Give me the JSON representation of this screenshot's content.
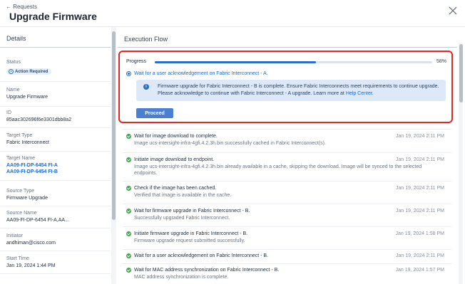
{
  "header": {
    "back_label": "← Requests",
    "title": "Upgrade Firmware"
  },
  "sidebar": {
    "title": "Details",
    "fields": [
      {
        "label": "Status",
        "badge": "Action Required"
      },
      {
        "label": "Name",
        "value": "Upgrade Firmware"
      },
      {
        "label": "ID",
        "value": "85aac302696f6e3301dbb8a2"
      },
      {
        "label": "Target Type",
        "value": "Fabric Interconnect"
      },
      {
        "label": "Target Name",
        "links": [
          "AA09-FI-DP-6454 FI-A",
          "AA09-FI-DP-6454 FI-B"
        ]
      },
      {
        "label": "Source Type",
        "value": "Firmware Upgrade"
      },
      {
        "label": "Source Name",
        "value": "AA09-FI-DP-6454 FI-A,AA..."
      },
      {
        "label": "Initiator",
        "value": "andhiman@cisco.com"
      },
      {
        "label": "Start Time",
        "value": "Jan 19, 2024 1:44 PM"
      }
    ]
  },
  "main": {
    "title": "Execution Flow",
    "progress_label": "Progress",
    "progress_percent": 58,
    "progress_text": "58%",
    "current_step": "Wait for a user acknowledgement on Fabric Interconnect - A.",
    "info_text_1": "Firmware upgrade for Fabric Interconnect - B is complete. Ensure Fabric Interconnects meet requirements to continue upgrade.",
    "info_text_2": "Please acknowledge to continue with Fabric Interconnect - A upgrade. Learn more at ",
    "info_link": "Help Center.",
    "proceed_label": "Proceed",
    "steps": [
      {
        "title": "Wait for image download to complete.",
        "detail": "Image ucs-intersight-infra-4gfi.4.2.3h.bin successfully cached in Fabric Interconnect(s).",
        "time": "Jan 19, 2024 2:11 PM"
      },
      {
        "title": "Initiate image download to endpoint.",
        "detail": "Image ucs-intersight-infra-4gfi.4.2.3h.bin already available in a cache, skipping the download. Image will be synced to the selected endpoints.",
        "time": "Jan 19, 2024 2:11 PM"
      },
      {
        "title": "Check if the image has been cached.",
        "detail": "Verified that image is available in the cache.",
        "time": "Jan 19, 2024 2:11 PM"
      },
      {
        "title": "Wait for firmware upgrade in Fabric Interconnect - B.",
        "detail": "Successfully upgraded Fabric Interconnect.",
        "time": "Jan 19, 2024 2:11 PM"
      },
      {
        "title": "Initiate firmware upgrade in Fabric Interconnect - B.",
        "detail": "Firmware upgrade request submitted successfully.",
        "time": "Jan 19, 2024 1:58 PM"
      },
      {
        "title": "Wait for a user acknowledgement on Fabric Interconnect - B.",
        "detail": "",
        "time": "Jan 19, 2024 2:11 PM"
      },
      {
        "title": "Wait for MAC address synchronization on Fabric Interconnect - B.",
        "detail": "MAC address synchronization is complete.",
        "time": "Jan 19, 2024 1:57 PM"
      }
    ]
  },
  "colors": {
    "accent": "#2b6fc4",
    "highlight_border": "#e52521",
    "success": "#3aa84a"
  },
  "icons": {
    "close": "close-icon",
    "info": "info-icon",
    "check": "check-circle-icon",
    "badge": "info-circle-icon"
  }
}
